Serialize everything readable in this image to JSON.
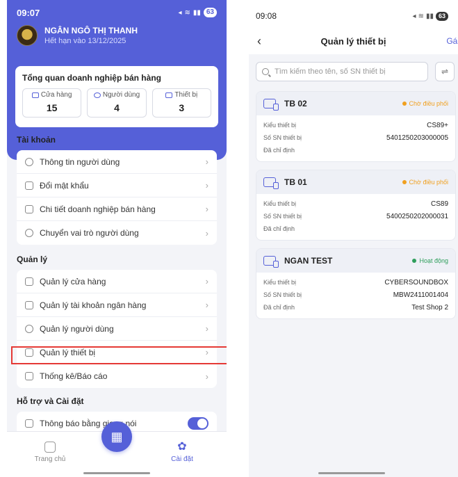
{
  "left": {
    "status": {
      "time": "09:07",
      "battery": "63"
    },
    "profile": {
      "name": "NGÂN NGÔ THỊ THANH",
      "expiry": "Hết hạn vào 13/12/2025"
    },
    "overview": {
      "title": "Tổng quan doanh nghiệp bán hàng",
      "stats": [
        {
          "label": "Cửa hàng",
          "value": "15",
          "icon": "store-icon"
        },
        {
          "label": "Người dùng",
          "value": "4",
          "icon": "users-icon"
        },
        {
          "label": "Thiết bị",
          "value": "3",
          "icon": "device-icon"
        }
      ]
    },
    "sections": {
      "account": "Tài khoản",
      "manage": "Quản lý",
      "support": "Hỗ trợ và Cài đặt"
    },
    "account_items": [
      "Thông tin người dùng",
      "Đổi mật khẩu",
      "Chi tiết doanh nghiệp bán hàng",
      "Chuyển vai trò người dùng"
    ],
    "manage_items": [
      "Quản lý cửa hàng",
      "Quản lý tài khoản ngân hàng",
      "Quản lý người dùng",
      "Quản lý thiết bị",
      "Thống kê/Báo cáo"
    ],
    "support_items": [
      "Thông báo bằng giọng nói"
    ],
    "tabs": {
      "home": "Trang chủ",
      "settings": "Cài đặt"
    }
  },
  "right": {
    "status": {
      "time": "09:08",
      "battery": "63"
    },
    "title": "Quản lý thiết bị",
    "assign": "Gán",
    "search_placeholder": "Tìm kiếm theo tên, số SN thiết bị",
    "labels": {
      "type": "Kiểu thiết bị",
      "sn": "Số SN thiết bị",
      "assigned": "Đã chỉ định"
    },
    "devices": [
      {
        "name": "TB 02",
        "status": "Chờ điều phối",
        "status_color": "#f0a020",
        "type": "CS89+",
        "sn": "5401250203000005",
        "assigned": ""
      },
      {
        "name": "TB 01",
        "status": "Chờ điều phối",
        "status_color": "#f0a020",
        "type": "CS89",
        "sn": "5400250202000031",
        "assigned": ""
      },
      {
        "name": "NGAN TEST",
        "status": "Hoạt động",
        "status_color": "#2e9e5b",
        "type": "CYBERSOUNDBOX",
        "sn": "MBW2411001404",
        "assigned": "Test Shop 2"
      }
    ]
  },
  "colors": {
    "accent": "#5560d8",
    "highlight": "#e53935"
  }
}
